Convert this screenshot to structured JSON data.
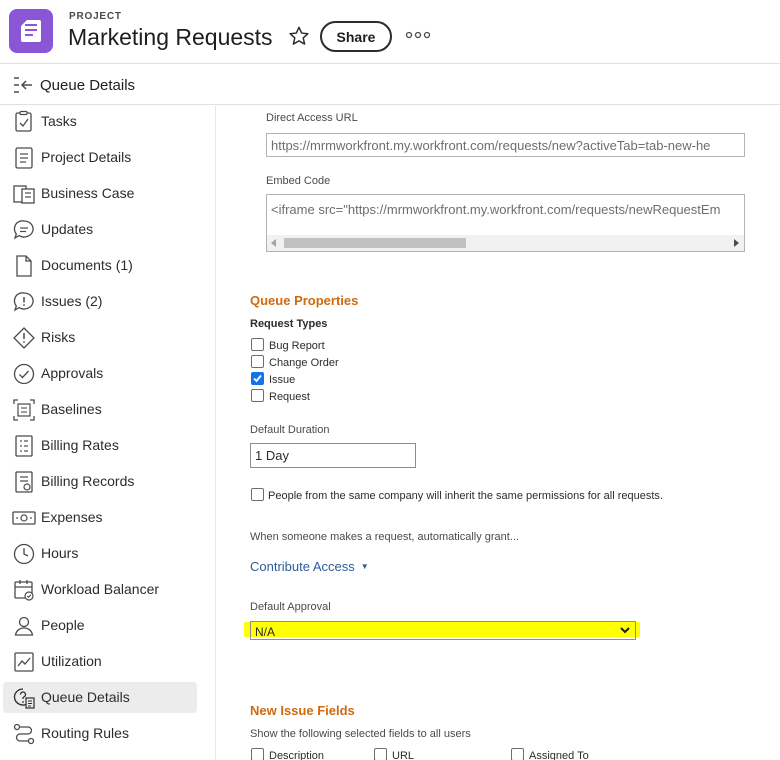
{
  "header": {
    "project_label": "PROJECT",
    "project_title": "Marketing Requests",
    "share_label": "Share",
    "project_icon": "project-icon",
    "favorite_icon": "star-icon",
    "more_icon": "more-icon",
    "accent_color": "#8a55d6"
  },
  "subheader": {
    "title": "Queue Details",
    "icon": "collapse-icon"
  },
  "sidebar": {
    "active": "Queue Details",
    "items": [
      {
        "label": "Tasks",
        "icon": "tasks-icon"
      },
      {
        "label": "Project Details",
        "icon": "details-icon"
      },
      {
        "label": "Business Case",
        "icon": "business-case-icon"
      },
      {
        "label": "Updates",
        "icon": "updates-icon"
      },
      {
        "label": "Documents (1)",
        "icon": "documents-icon"
      },
      {
        "label": "Issues (2)",
        "icon": "issues-icon"
      },
      {
        "label": "Risks",
        "icon": "risks-icon"
      },
      {
        "label": "Approvals",
        "icon": "approvals-icon"
      },
      {
        "label": "Baselines",
        "icon": "baselines-icon"
      },
      {
        "label": "Billing Rates",
        "icon": "billing-rates-icon"
      },
      {
        "label": "Billing Records",
        "icon": "billing-records-icon"
      },
      {
        "label": "Expenses",
        "icon": "expenses-icon"
      },
      {
        "label": "Hours",
        "icon": "hours-icon"
      },
      {
        "label": "Workload Balancer",
        "icon": "workload-balancer-icon"
      },
      {
        "label": "People",
        "icon": "people-icon"
      },
      {
        "label": "Utilization",
        "icon": "utilization-icon"
      },
      {
        "label": "Queue Details",
        "icon": "queue-details-icon"
      },
      {
        "label": "Routing Rules",
        "icon": "routing-rules-icon"
      }
    ]
  },
  "main": {
    "direct_access": {
      "label": "Direct Access URL",
      "value": "https://mrmworkfront.my.workfront.com/requests/new?activeTab=tab-new-he"
    },
    "embed_code": {
      "label": "Embed Code",
      "value": "<iframe src=\"https://mrmworkfront.my.workfront.com/requests/newRequestEm"
    },
    "queue_properties": {
      "title": "Queue Properties",
      "request_types_label": "Request Types",
      "request_types": [
        {
          "label": "Bug Report",
          "checked": false
        },
        {
          "label": "Change Order",
          "checked": false
        },
        {
          "label": "Issue",
          "checked": true
        },
        {
          "label": "Request",
          "checked": false
        }
      ],
      "default_duration_label": "Default Duration",
      "default_duration_value": "1 Day",
      "inherit_permissions_label": "People from the same company will inherit the same permissions for all requests.",
      "inherit_permissions_checked": false,
      "grant_text": "When someone makes a request, automatically grant...",
      "access_level": "Contribute Access",
      "default_approval_label": "Default Approval",
      "default_approval_value": "N/A"
    },
    "new_issue_fields": {
      "title": "New Issue Fields",
      "description": "Show the following selected fields to all users",
      "fields": [
        {
          "label": "Description",
          "checked": false
        },
        {
          "label": "URL",
          "checked": false
        },
        {
          "label": "Assigned To",
          "checked": false
        }
      ]
    }
  },
  "colors": {
    "section_title": "#cf6a0f",
    "checkbox_checked": "#1473e6",
    "link": "#2c5d99",
    "highlight": "#ffff00"
  }
}
